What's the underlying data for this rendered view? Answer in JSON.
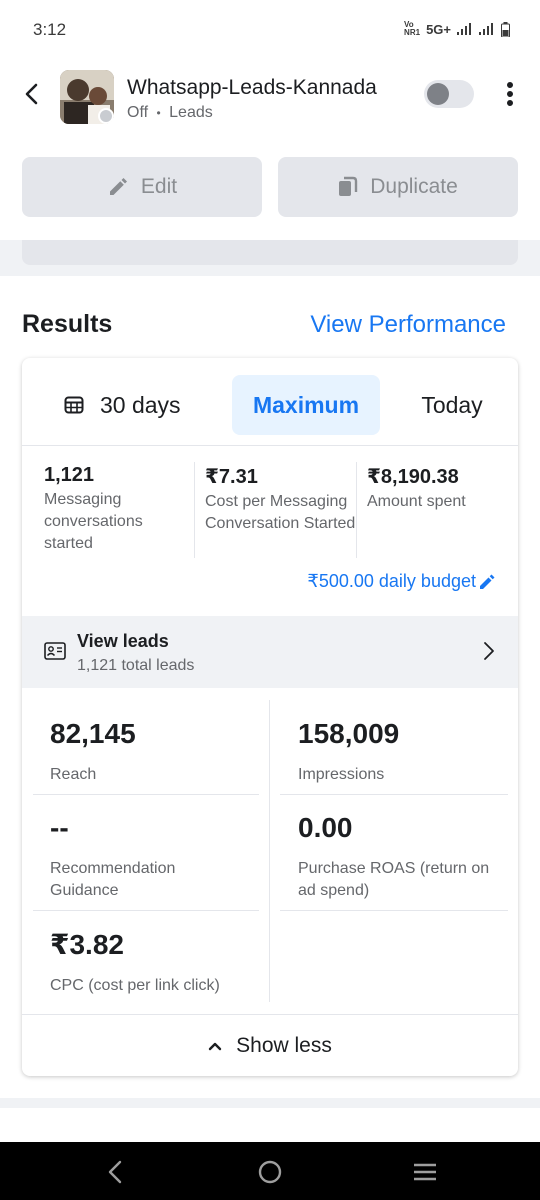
{
  "status_bar": {
    "time": "3:12",
    "network_label_top": "Vo",
    "network_label_bottom": "NR1",
    "network_type": "5G+"
  },
  "header": {
    "campaign_name": "Whatsapp-Leads-Kannada",
    "status": "Off",
    "separator": "•",
    "objective": "Leads"
  },
  "actions": {
    "edit_label": "Edit",
    "duplicate_label": "Duplicate"
  },
  "results": {
    "title": "Results",
    "view_performance": "View Performance",
    "tabs": [
      "30 days",
      "Maximum",
      "Today"
    ],
    "selected_tab": "Maximum",
    "summary": [
      {
        "value": "1,121",
        "label": "Messaging conversations started"
      },
      {
        "value": "₹7.31",
        "label": "Cost per Messaging Conversation Started"
      },
      {
        "value": "₹8,190.38",
        "label": "Amount spent"
      }
    ],
    "budget_label": "₹500.00 daily budget",
    "leads": {
      "title": "View leads",
      "subtitle": "1,121 total leads"
    },
    "stats": [
      {
        "value": "82,145",
        "label": "Reach"
      },
      {
        "value": "158,009",
        "label": "Impressions"
      },
      {
        "value": "--",
        "label": "Recommendation Guidance"
      },
      {
        "value": "0.00",
        "label": "Purchase ROAS (return on ad spend)"
      },
      {
        "value": "₹3.82",
        "label": "CPC (cost per link click)"
      }
    ],
    "show_less": "Show less"
  },
  "colors": {
    "accent": "#1877f2",
    "selected_tab_bg": "#e7f3ff",
    "disabled_button_bg": "#e4e6eb",
    "muted_text": "#65676b"
  },
  "icons": [
    "chevron-left-icon",
    "more-vertical-icon",
    "pencil-icon",
    "copy-icon",
    "calendar-icon",
    "lead-card-icon",
    "chevron-right-icon",
    "chevron-up-icon",
    "nav-back-icon",
    "nav-home-icon",
    "nav-recents-icon"
  ]
}
